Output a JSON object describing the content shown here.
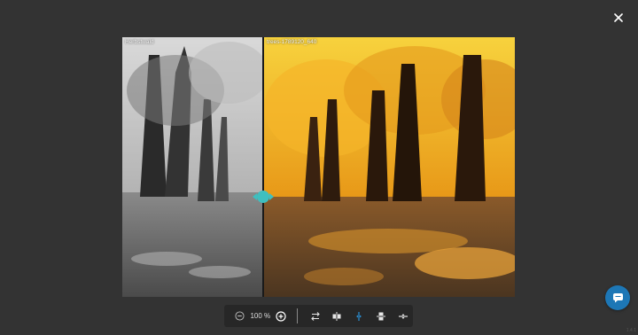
{
  "viewer": {
    "left_image_label": "Herbstwald",
    "right_image_label": "trees-1789120_640",
    "split_position": 0.36
  },
  "toolbar": {
    "zoom_level": "100 %",
    "zoom_out_icon": "minus-circle-icon",
    "zoom_in_icon": "plus-circle-icon",
    "tools": [
      {
        "name": "swap-images",
        "icon": "swap-arrows-icon"
      },
      {
        "name": "vertical-split",
        "icon": "vertical-split-icon"
      },
      {
        "name": "vertical-line",
        "icon": "vertical-line-icon",
        "active": true
      },
      {
        "name": "horizontal-split",
        "icon": "horizontal-split-icon"
      },
      {
        "name": "horizontal-line",
        "icon": "horizontal-line-icon"
      }
    ]
  },
  "colors": {
    "background": "#333333",
    "toolbar": "#272727",
    "accent": "#3fbfbf",
    "active_tool": "#2a8fd6",
    "chat_fab": "#1d77b6"
  },
  "corner_text": "1.4.1"
}
